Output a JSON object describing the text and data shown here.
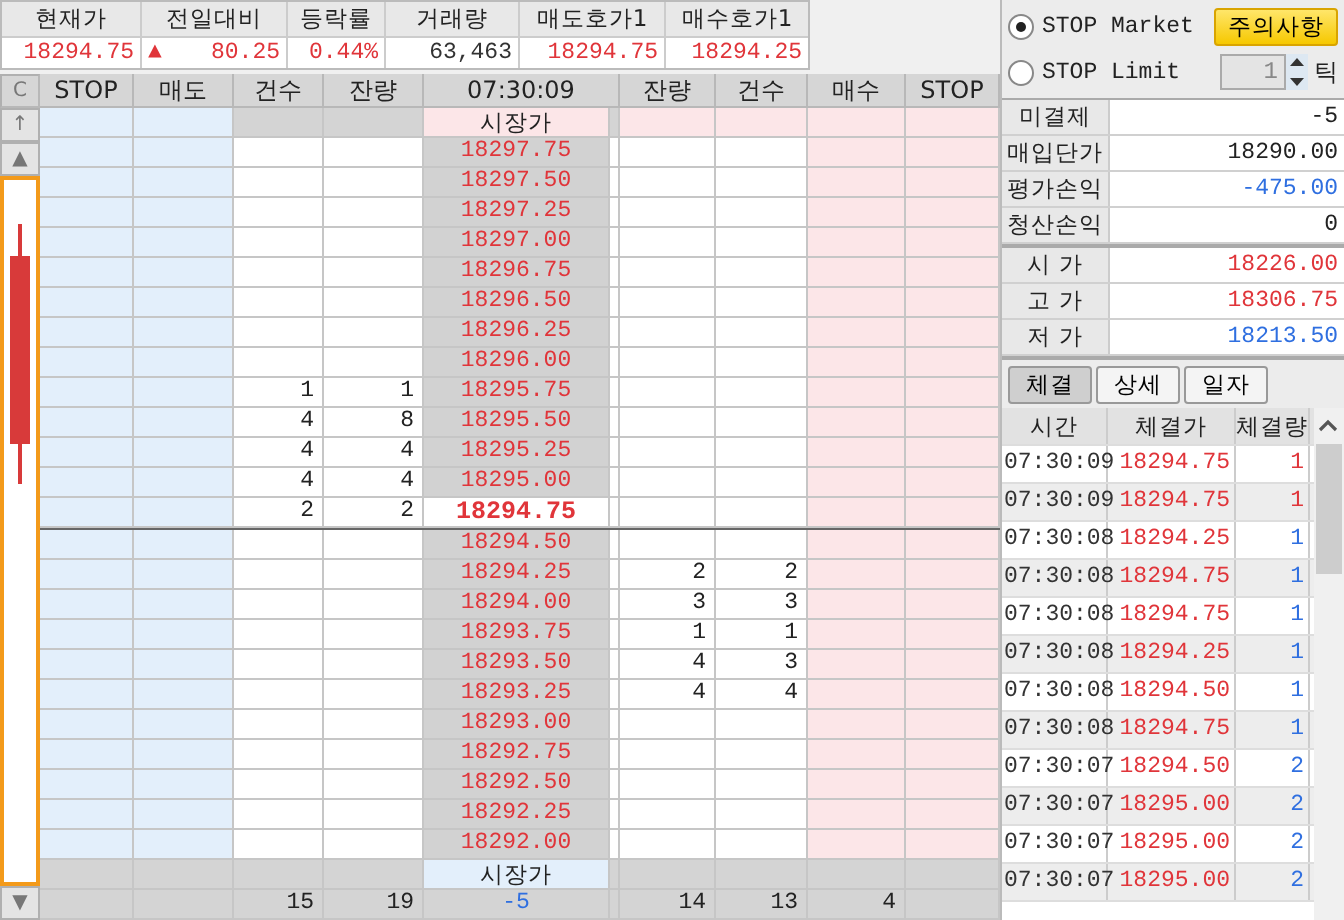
{
  "summary": [
    {
      "label": "현재가",
      "value": "18294.75",
      "color": "#e0353a"
    },
    {
      "label": "전일대비",
      "sign": "▲",
      "value": "80.25",
      "color": "#e0353a"
    },
    {
      "label": "등락률",
      "value": "0.44%",
      "color": "#e0353a"
    },
    {
      "label": "거래량",
      "value": "63,463",
      "color": "#333333"
    },
    {
      "label": "매도호가1",
      "value": "18294.75",
      "color": "#e0353a"
    },
    {
      "label": "매수호가1",
      "value": "18294.25",
      "color": "#e0353a"
    }
  ],
  "sidebar": {
    "clear": "C",
    "top": "↑",
    "up": "▲",
    "down": "▼"
  },
  "orderbook": {
    "columns": [
      "STOP",
      "매도",
      "건수",
      "잔량",
      "07:30:09",
      "잔량",
      "건수",
      "매수",
      "STOP"
    ],
    "top_market": "시장가",
    "rows": [
      {
        "price": "18297.75",
        "current": false
      },
      {
        "price": "18297.50",
        "current": false
      },
      {
        "price": "18297.25",
        "current": false
      },
      {
        "price": "18297.00",
        "current": false
      },
      {
        "price": "18296.75",
        "current": false
      },
      {
        "price": "18296.50",
        "current": false
      },
      {
        "price": "18296.25",
        "current": false
      },
      {
        "price": "18296.00",
        "current": false
      },
      {
        "price": "18295.75",
        "ask_count": "1",
        "ask_qty": "1",
        "current": false
      },
      {
        "price": "18295.50",
        "ask_count": "4",
        "ask_qty": "8",
        "current": false
      },
      {
        "price": "18295.25",
        "ask_count": "4",
        "ask_qty": "4",
        "current": false
      },
      {
        "price": "18295.00",
        "ask_count": "4",
        "ask_qty": "4",
        "current": false
      },
      {
        "price": "18294.75",
        "ask_count": "2",
        "ask_qty": "2",
        "current": true
      },
      {
        "price": "18294.50",
        "current": false
      },
      {
        "price": "18294.25",
        "bid_qty": "2",
        "bid_count": "2",
        "current": false
      },
      {
        "price": "18294.00",
        "bid_qty": "3",
        "bid_count": "3",
        "current": false
      },
      {
        "price": "18293.75",
        "bid_qty": "1",
        "bid_count": "1",
        "current": false
      },
      {
        "price": "18293.50",
        "bid_qty": "4",
        "bid_count": "3",
        "current": false
      },
      {
        "price": "18293.25",
        "bid_qty": "4",
        "bid_count": "4",
        "current": false
      },
      {
        "price": "18293.00",
        "current": false
      },
      {
        "price": "18292.75",
        "current": false
      },
      {
        "price": "18292.50",
        "current": false
      },
      {
        "price": "18292.25",
        "current": false
      },
      {
        "price": "18292.00",
        "current": false
      }
    ],
    "bottom_market": "시장가",
    "totals": {
      "ask_count": "15",
      "ask_qty": "19",
      "net": "-5",
      "bid_qty": "14",
      "bid_count": "13",
      "buy": "4"
    }
  },
  "stop_options": [
    {
      "label": "STOP Market",
      "selected": true
    },
    {
      "label": "STOP Limit",
      "selected": false
    }
  ],
  "notice_button": "주의사항",
  "tick": {
    "value": "1",
    "unit": "틱"
  },
  "position": [
    {
      "label": "미결제",
      "value": "-5",
      "color": "#222222"
    },
    {
      "label": "매입단가",
      "value": "18290.00",
      "color": "#222222"
    },
    {
      "label": "평가손익",
      "value": "-475.00",
      "color": "#2f6fe0"
    },
    {
      "label": "청산손익",
      "value": "0",
      "color": "#222222"
    }
  ],
  "prices": [
    {
      "label": "시 가",
      "value": "18226.00",
      "color": "#e0353a"
    },
    {
      "label": "고 가",
      "value": "18306.75",
      "color": "#e0353a"
    },
    {
      "label": "저 가",
      "value": "18213.50",
      "color": "#2f6fe0"
    }
  ],
  "tabs": [
    {
      "label": "체결",
      "selected": true
    },
    {
      "label": "상세",
      "selected": false
    },
    {
      "label": "일자",
      "selected": false
    }
  ],
  "trades": {
    "columns": [
      "시간",
      "체결가",
      "체결량"
    ],
    "rows": [
      {
        "time": "07:30:09",
        "price": "18294.75",
        "qty": "1",
        "color": "#e0353a"
      },
      {
        "time": "07:30:09",
        "price": "18294.75",
        "qty": "1",
        "color": "#e0353a"
      },
      {
        "time": "07:30:08",
        "price": "18294.25",
        "qty": "1",
        "color": "#2f6fe0"
      },
      {
        "time": "07:30:08",
        "price": "18294.75",
        "qty": "1",
        "color": "#2f6fe0"
      },
      {
        "time": "07:30:08",
        "price": "18294.75",
        "qty": "1",
        "color": "#2f6fe0"
      },
      {
        "time": "07:30:08",
        "price": "18294.25",
        "qty": "1",
        "color": "#2f6fe0"
      },
      {
        "time": "07:30:08",
        "price": "18294.50",
        "qty": "1",
        "color": "#2f6fe0"
      },
      {
        "time": "07:30:08",
        "price": "18294.75",
        "qty": "1",
        "color": "#2f6fe0"
      },
      {
        "time": "07:30:07",
        "price": "18294.50",
        "qty": "2",
        "color": "#2f6fe0"
      },
      {
        "time": "07:30:07",
        "price": "18295.00",
        "qty": "2",
        "color": "#2f6fe0"
      },
      {
        "time": "07:30:07",
        "price": "18295.00",
        "qty": "2",
        "color": "#2f6fe0"
      },
      {
        "time": "07:30:07",
        "price": "18295.00",
        "qty": "2",
        "color": "#2f6fe0"
      }
    ]
  }
}
